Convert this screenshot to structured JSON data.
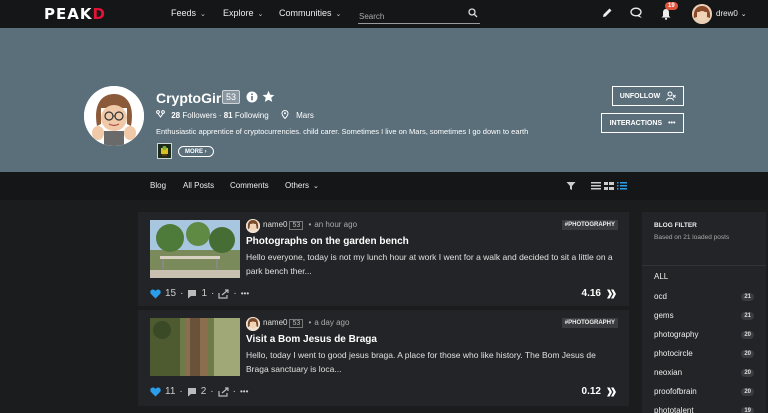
{
  "nav": {
    "logo_main": "PEAK",
    "logo_accent": "D",
    "feeds": "Feeds",
    "explore": "Explore",
    "communities": "Communities",
    "search_placeholder": "Search",
    "notification_count": "19",
    "username": "drew0"
  },
  "profile": {
    "name": "CryptoGirl",
    "reputation": "53",
    "followers_count": "28",
    "followers_label": "Followers",
    "following_count": "81",
    "following_label": "Following",
    "location": "Mars",
    "bio": "Enthusiastic apprentice of cryptocurrencies. child carer. Sometimes I live on Mars, sometimes I go down to earth",
    "more_label": "MORE",
    "unfollow_label": "UNFOLLOW",
    "interactions_label": "INTERACTIONS"
  },
  "tabs": {
    "blog": "Blog",
    "all_posts": "All Posts",
    "comments": "Comments",
    "others": "Others"
  },
  "posts": [
    {
      "author": "name0",
      "reputation": "53",
      "time": "an hour ago",
      "tag": "#PHOTOGRAPHY",
      "title": "Photographs on the garden bench",
      "excerpt": "Hello everyone, today is not my lunch hour at work I went for a walk and decided to sit a little on a park bench ther...",
      "likes": "15",
      "comments": "1",
      "payout": "4.16"
    },
    {
      "author": "name0",
      "reputation": "53",
      "time": "a day ago",
      "tag": "#PHOTOGRAPHY",
      "title": "Visit a Bom Jesus de Braga",
      "excerpt": "Hello, today I went to good jesus braga. A place for those who like history. The Bom Jesus de Braga sanctuary is loca...",
      "likes": "11",
      "comments": "2",
      "payout": "0.12"
    }
  ],
  "sidebar": {
    "title": "BLOG FILTER",
    "subtitle": "Based on 21 loaded posts",
    "all_label": "ALL",
    "filters": [
      {
        "label": "ocd",
        "count": "21"
      },
      {
        "label": "gems",
        "count": "21"
      },
      {
        "label": "photography",
        "count": "20"
      },
      {
        "label": "photocircle",
        "count": "20"
      },
      {
        "label": "neoxian",
        "count": "20"
      },
      {
        "label": "proofofbrain",
        "count": "20"
      },
      {
        "label": "phototalent",
        "count": "19"
      }
    ]
  },
  "colors": {
    "accent": "#e31337",
    "cover": "#5b6f7b",
    "like": "#2a9ee8",
    "notification": "#e0533a"
  }
}
